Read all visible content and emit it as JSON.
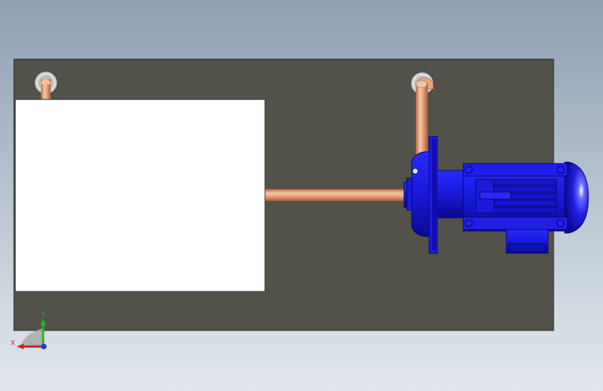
{
  "app": {
    "window_title": ""
  },
  "scene": {
    "background_top": "#8fa0b3",
    "background_bottom": "#dfe5eb",
    "base_plate_color": "#52524b",
    "tank_color": "#ffffff",
    "pipe_color": "#e9a47d",
    "pump_color": "#1414d0",
    "components": {
      "base_plate": "base-plate",
      "tank": "tank",
      "pump": "centrifugal-pump",
      "motor": "electric-motor"
    }
  },
  "triad": {
    "x_label": "X",
    "y_label": "Y",
    "x_color": "#d21f1f",
    "y_color": "#1fb81f",
    "z_color": "#1f3fd2"
  }
}
